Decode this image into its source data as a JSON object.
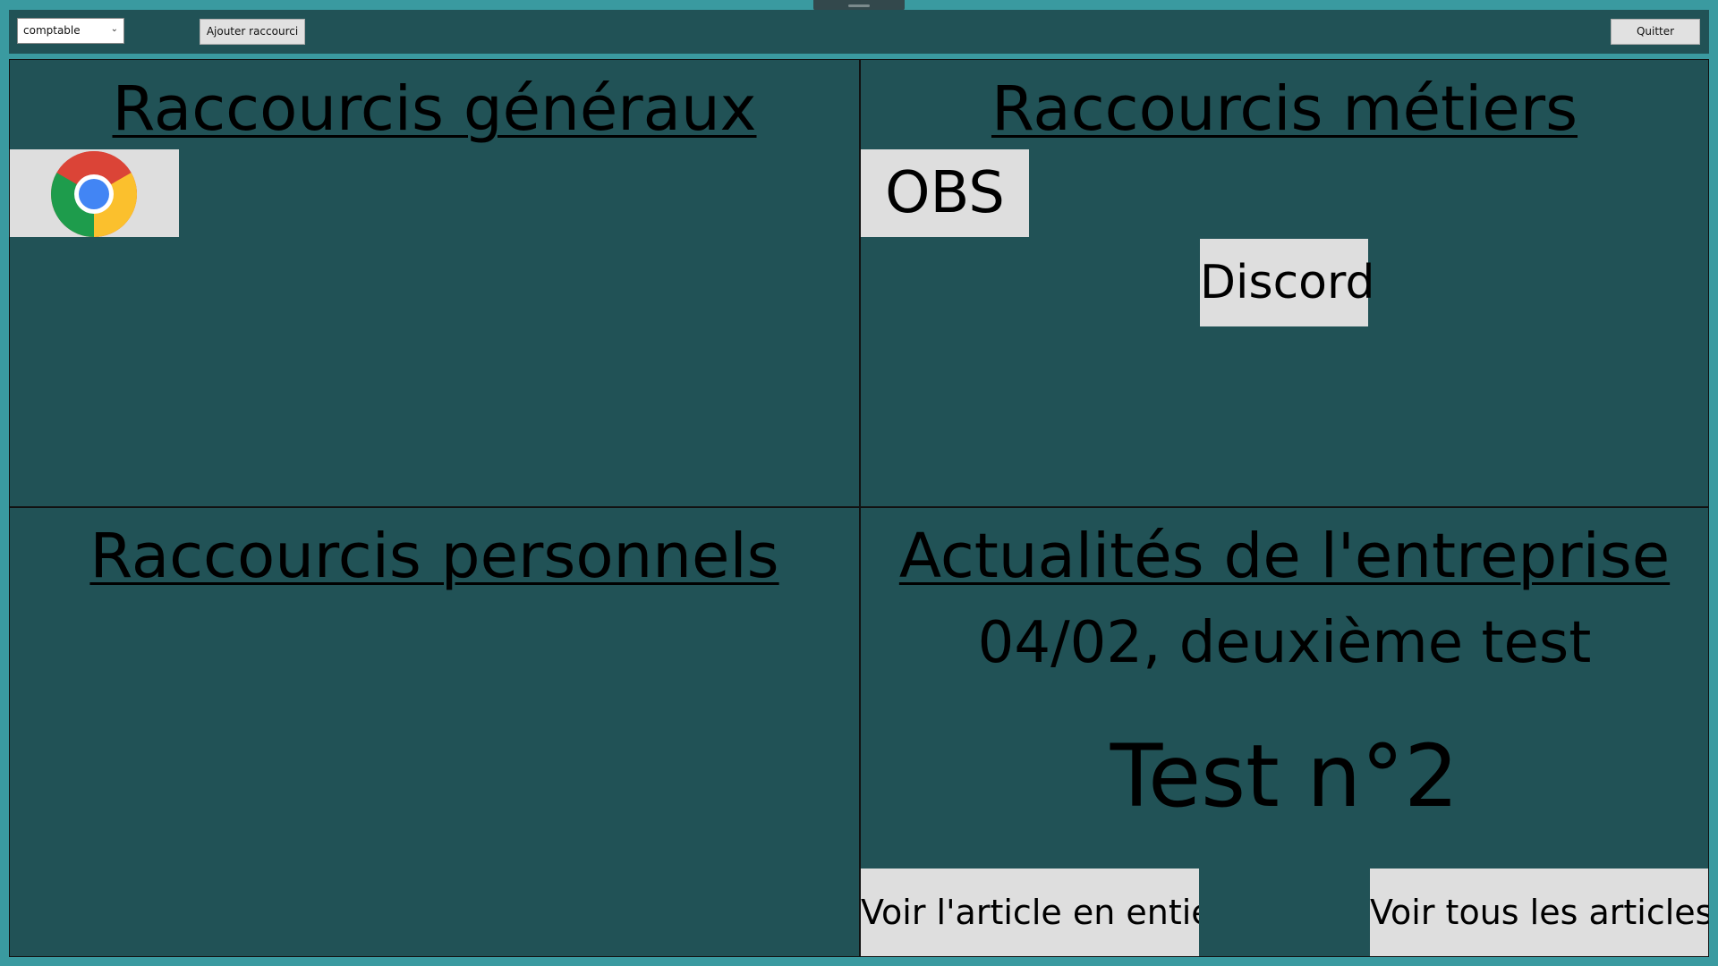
{
  "toolbar": {
    "role_select_value": "comptable",
    "add_shortcut_label": "Ajouter raccourci",
    "quit_label": "Quitter"
  },
  "sections": {
    "general": {
      "title": "Raccourcis généraux",
      "shortcuts": [
        {
          "name": "chrome-icon"
        }
      ]
    },
    "metiers": {
      "title": "Raccourcis métiers",
      "shortcuts": [
        {
          "label": "OBS"
        },
        {
          "label": "Discord"
        }
      ]
    },
    "personal": {
      "title": "Raccourcis personnels"
    },
    "news": {
      "title": "Actualités de l'entreprise",
      "date_line": "04/02, deuxième test",
      "headline": "Test n°2",
      "read_article_label": "Voir l'article en entier",
      "all_articles_label": "Voir tous les articles"
    }
  },
  "colors": {
    "window_border": "#3a9aa0",
    "panel_bg": "#215256",
    "tile_bg": "#dedede"
  }
}
